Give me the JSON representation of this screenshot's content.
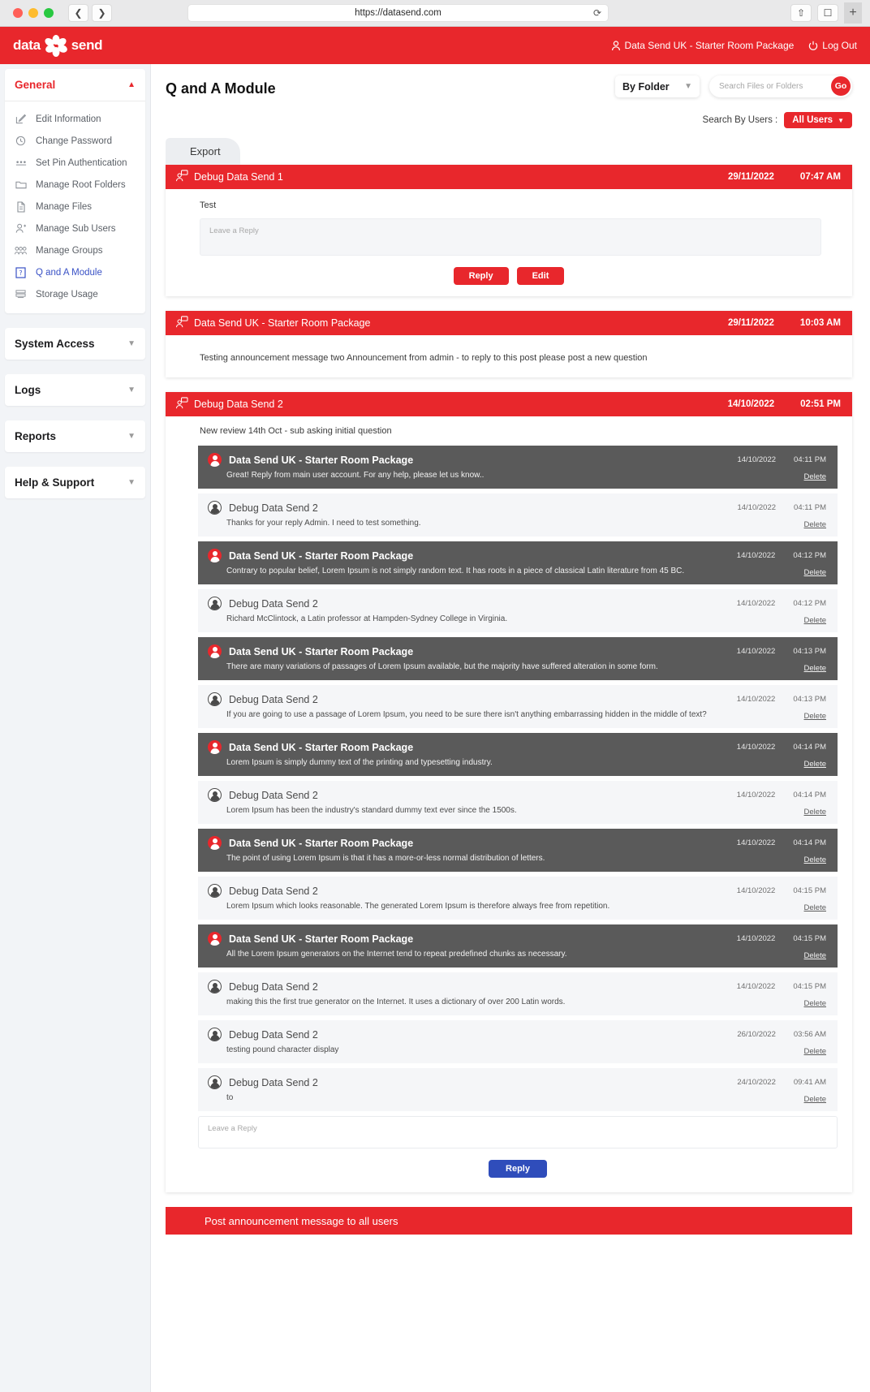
{
  "browser": {
    "url": "https://datasend.com",
    "back_icon": "chevron-left-icon",
    "forward_icon": "chevron-right-icon",
    "reload_icon": "reload-icon",
    "share_icon": "share-icon",
    "tabs_icon": "tabs-icon",
    "new_tab_icon": "plus-icon"
  },
  "app_header": {
    "logo_left": "data",
    "logo_right": "send",
    "account": "Data Send UK - Starter Room Package",
    "logout": "Log Out",
    "account_icon": "user-icon",
    "logout_icon": "power-icon",
    "brand_color": "#e8272c"
  },
  "sidebar": {
    "sections": [
      {
        "label": "General",
        "expanded": true,
        "chevron": "chevron-up-icon"
      },
      {
        "label": "System Access",
        "expanded": false,
        "chevron": "chevron-down-icon"
      },
      {
        "label": "Logs",
        "expanded": false,
        "chevron": "chevron-down-icon"
      },
      {
        "label": "Reports",
        "expanded": false,
        "chevron": "chevron-down-icon"
      },
      {
        "label": "Help & Support",
        "expanded": false,
        "chevron": "chevron-down-icon"
      }
    ],
    "items": [
      {
        "label": "Edit Information",
        "icon": "edit-icon",
        "selected": false
      },
      {
        "label": "Change Password",
        "icon": "key-history-icon",
        "selected": false
      },
      {
        "label": "Set Pin Authentication",
        "icon": "pin-dots-icon",
        "selected": false
      },
      {
        "label": "Manage Root Folders",
        "icon": "folder-icon",
        "selected": false
      },
      {
        "label": "Manage Files",
        "icon": "file-icon",
        "selected": false
      },
      {
        "label": "Manage Sub Users",
        "icon": "user-plus-icon",
        "selected": false
      },
      {
        "label": "Manage Groups",
        "icon": "users-group-icon",
        "selected": false
      },
      {
        "label": "Q and A Module",
        "icon": "question-book-icon",
        "selected": true
      },
      {
        "label": "Storage Usage",
        "icon": "database-icon",
        "selected": false
      }
    ]
  },
  "main": {
    "page_title": "Q and A Module",
    "folder_select": {
      "value": "By Folder",
      "chevron": "chevron-down-icon"
    },
    "search": {
      "placeholder": "Search Files or Folders",
      "value": "",
      "go_label": "Go"
    },
    "search_by_users_label": "Search By Users :",
    "all_users_button": {
      "label": "All Users",
      "chevron": "caret-down-icon"
    },
    "export_tab": "Export",
    "announcement_bar": "Post announcement message to all users"
  },
  "posts": [
    {
      "author": "Debug Data Send 1",
      "date": "29/11/2022",
      "time": "07:47 AM",
      "text": "Test",
      "reply_placeholder": "Leave a Reply",
      "buttons": [
        "Reply",
        "Edit"
      ],
      "has_reply_box": true,
      "replies": []
    },
    {
      "author": "Data Send UK - Starter Room Package",
      "date": "29/11/2022",
      "time": "10:03 AM",
      "text": "Testing announcement message two  Announcement from admin - to reply to this post please post a new question",
      "reply_placeholder": "",
      "buttons": [],
      "has_reply_box": false,
      "replies": []
    },
    {
      "author": "Debug Data Send 2",
      "date": "14/10/2022",
      "time": "02:51 PM",
      "text": "New review 14th Oct - sub asking initial question",
      "reply_placeholder": "Leave a Reply",
      "buttons": [
        "Reply"
      ],
      "has_reply_box": true,
      "replies": [
        {
          "role": "admin",
          "author": "Data Send UK - Starter Room Package",
          "date": "14/10/2022",
          "time": "04:11 PM",
          "text": "Great! Reply from main user account. For any help, please let us know..",
          "delete": "Delete"
        },
        {
          "role": "user",
          "author": "Debug Data Send 2",
          "date": "14/10/2022",
          "time": "04:11 PM",
          "text": "Thanks for your reply Admin. I need to test something.",
          "delete": "Delete"
        },
        {
          "role": "admin",
          "author": "Data Send UK - Starter Room Package",
          "date": "14/10/2022",
          "time": "04:12 PM",
          "text": "Contrary to popular belief, Lorem Ipsum is not simply random text. It has roots in a piece of classical Latin literature from 45 BC.",
          "delete": "Delete"
        },
        {
          "role": "user",
          "author": "Debug Data Send 2",
          "date": "14/10/2022",
          "time": "04:12 PM",
          "text": "Richard McClintock, a Latin professor at Hampden-Sydney College in Virginia.",
          "delete": "Delete"
        },
        {
          "role": "admin",
          "author": "Data Send UK - Starter Room Package",
          "date": "14/10/2022",
          "time": "04:13 PM",
          "text": "There are many variations of passages of Lorem Ipsum available, but the majority have suffered alteration in some form.",
          "delete": "Delete"
        },
        {
          "role": "user",
          "author": "Debug Data Send 2",
          "date": "14/10/2022",
          "time": "04:13 PM",
          "text": "If you are going to use a passage of Lorem Ipsum, you need to be sure there isn't anything embarrassing hidden in the middle of text?",
          "delete": "Delete"
        },
        {
          "role": "admin",
          "author": "Data Send UK - Starter Room Package",
          "date": "14/10/2022",
          "time": "04:14 PM",
          "text": "Lorem Ipsum is simply dummy text of the printing and typesetting industry.",
          "delete": "Delete"
        },
        {
          "role": "user",
          "author": "Debug Data Send 2",
          "date": "14/10/2022",
          "time": "04:14 PM",
          "text": "Lorem Ipsum has been the industry's standard dummy text ever since the 1500s.",
          "delete": "Delete"
        },
        {
          "role": "admin",
          "author": "Data Send UK - Starter Room Package",
          "date": "14/10/2022",
          "time": "04:14 PM",
          "text": "The point of using Lorem Ipsum is that it has a more-or-less normal distribution of letters.",
          "delete": "Delete"
        },
        {
          "role": "user",
          "author": "Debug Data Send 2",
          "date": "14/10/2022",
          "time": "04:15 PM",
          "text": "Lorem Ipsum which looks reasonable. The generated Lorem Ipsum is therefore always free from repetition.",
          "delete": "Delete"
        },
        {
          "role": "admin",
          "author": "Data Send UK - Starter Room Package",
          "date": "14/10/2022",
          "time": "04:15 PM",
          "text": "All the Lorem Ipsum generators on the Internet tend to repeat predefined chunks as necessary.",
          "delete": "Delete"
        },
        {
          "role": "user",
          "author": "Debug Data Send 2",
          "date": "14/10/2022",
          "time": "04:15 PM",
          "text": "making this the first true generator on the Internet. It uses a dictionary of over 200 Latin words.",
          "delete": "Delete"
        },
        {
          "role": "user",
          "author": "Debug Data Send 2",
          "date": "26/10/2022",
          "time": "03:56 AM",
          "text": "testing pound character display",
          "delete": "Delete"
        },
        {
          "role": "user",
          "author": "Debug Data Send 2",
          "date": "24/10/2022",
          "time": "09:41 AM",
          "text": "to",
          "delete": "Delete"
        }
      ],
      "thread_reply_placeholder": "Leave a Reply",
      "thread_button": "Reply"
    }
  ]
}
